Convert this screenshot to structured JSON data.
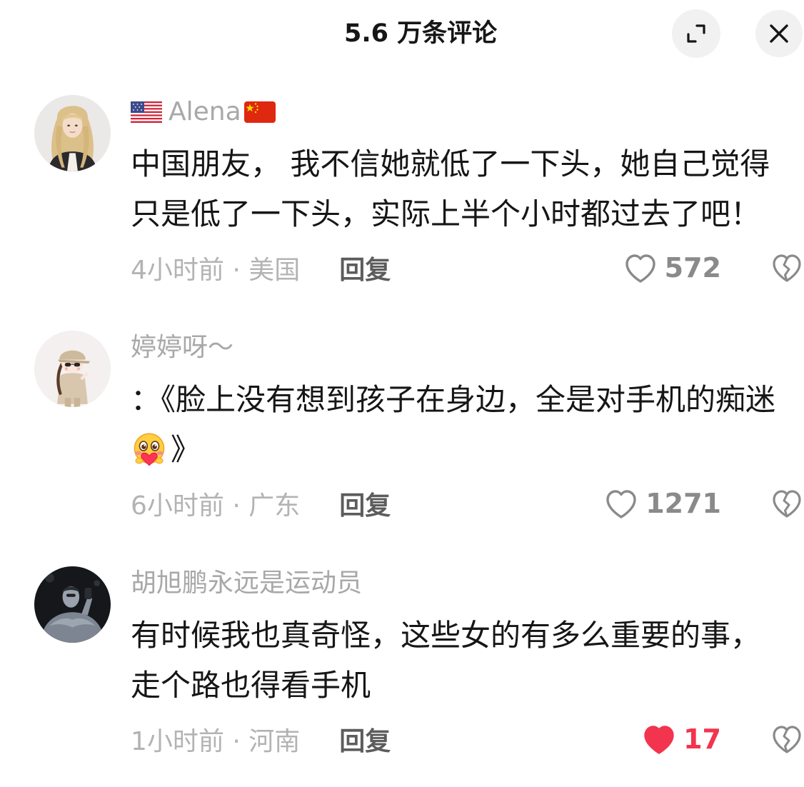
{
  "header": {
    "title": "5.6 万条评论",
    "expand_icon": "expand-icon",
    "close_icon": "close-icon"
  },
  "comments": [
    {
      "avatar": "avatar-blonde-woman",
      "username_flags": [
        "us-flag-icon",
        "china-flag-icon"
      ],
      "username": "Alena",
      "lines": [
        "中国朋友， 我不信她就低了一下头，她自己觉得",
        "只是低了一下头，实际上半个小时都过去了吧！"
      ],
      "meta": "4小时前 · 美国",
      "reply_label": "回复",
      "like_icon": "heart-outline-icon",
      "likes": "572",
      "liked": false,
      "dislike_icon": "broken-heart-icon"
    },
    {
      "avatar": "avatar-cartoon-girl",
      "username": "婷婷呀～",
      "lines": [
        "：《脸上没有想到孩子在身边，全是对手机的痴迷",
        "》"
      ],
      "inline_emoji": "blush-heart-emoji-icon",
      "meta": "6小时前 · 广东",
      "reply_label": "回复",
      "like_icon": "heart-outline-icon",
      "likes": "1271",
      "liked": false,
      "dislike_icon": "broken-heart-icon"
    },
    {
      "avatar": "avatar-dark-photo-man",
      "username": "胡旭鹏永远是运动员",
      "lines": [
        "有时候我也真奇怪，这些女的有多么重要的事，",
        "走个路也得看手机"
      ],
      "meta": "1小时前 · 河南",
      "reply_label": "回复",
      "like_icon": "heart-filled-icon",
      "likes": "17",
      "liked": true,
      "dislike_icon": "broken-heart-icon"
    }
  ],
  "colors": {
    "text_primary": "#161616",
    "text_muted": "#a8a8a8",
    "meta_text": "#b3b3b3",
    "reply_text": "#5c5c5c",
    "icon_gray": "#8a8a8a",
    "like_active": "#f2344f",
    "button_bg": "#f1f1f2",
    "background": "#ffffff"
  }
}
